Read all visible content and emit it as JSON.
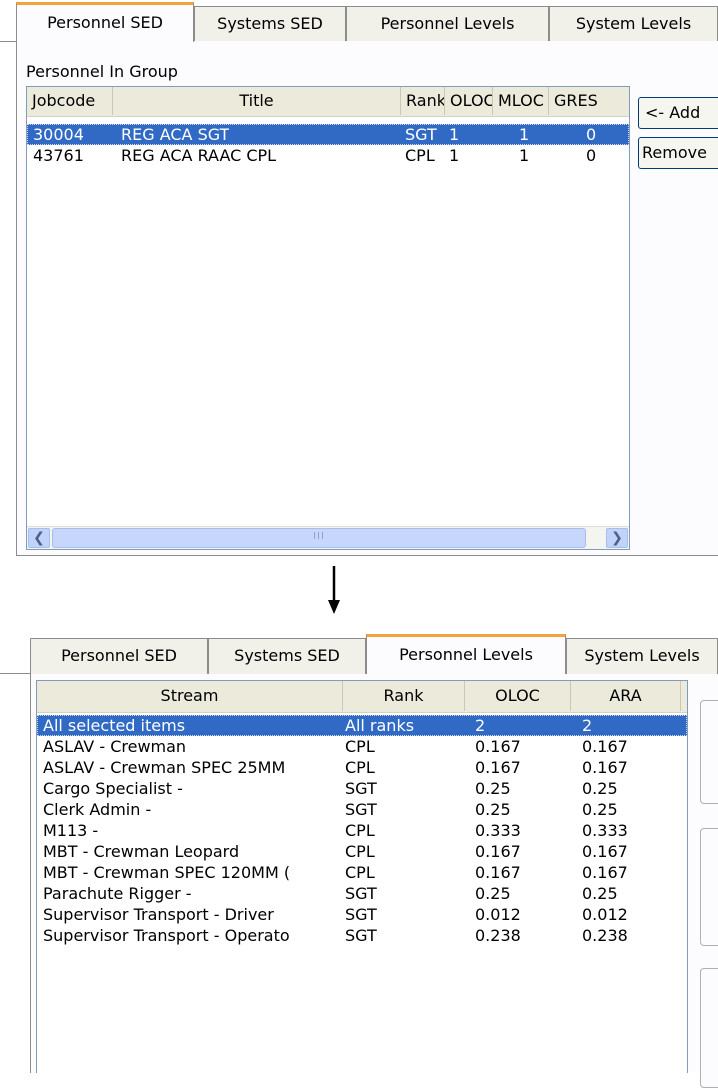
{
  "top": {
    "tabs": [
      "Personnel SED",
      "Systems SED",
      "Personnel Levels",
      "System Levels"
    ],
    "active_tab": 0,
    "group_label": "Personnel In Group",
    "columns": [
      "Jobcode",
      "Title",
      "Rank",
      "OLOC",
      "MLOC",
      "GRES"
    ],
    "rows": [
      {
        "jobcode": "30004",
        "title": "REG ACA SGT",
        "rank": "SGT",
        "oloc": "1",
        "mloc": "1",
        "gres": "0",
        "selected": true
      },
      {
        "jobcode": "43761",
        "title": "REG ACA RAAC CPL",
        "rank": "CPL",
        "oloc": "1",
        "mloc": "1",
        "gres": "0",
        "selected": false
      }
    ],
    "add_button": "<- Add",
    "remove_button": "Remove",
    "scroll_thumb_grip": "III"
  },
  "bottom": {
    "tabs": [
      "Personnel SED",
      "Systems SED",
      "Personnel Levels",
      "System Levels"
    ],
    "active_tab": 2,
    "columns": [
      "Stream",
      "Rank",
      "OLOC",
      "ARA"
    ],
    "rows": [
      {
        "stream": "All selected items",
        "rank": "All ranks",
        "oloc": "2",
        "ara": "2",
        "selected": true
      },
      {
        "stream": "ASLAV - Crewman",
        "rank": "CPL",
        "oloc": "0.167",
        "ara": "0.167",
        "selected": false
      },
      {
        "stream": "ASLAV - Crewman SPEC 25MM",
        "rank": "CPL",
        "oloc": "0.167",
        "ara": "0.167",
        "selected": false
      },
      {
        "stream": "Cargo Specialist -",
        "rank": "SGT",
        "oloc": "0.25",
        "ara": "0.25",
        "selected": false
      },
      {
        "stream": "Clerk Admin -",
        "rank": "SGT",
        "oloc": "0.25",
        "ara": "0.25",
        "selected": false
      },
      {
        "stream": "M113 -",
        "rank": "CPL",
        "oloc": "0.333",
        "ara": "0.333",
        "selected": false
      },
      {
        "stream": "MBT - Crewman Leopard",
        "rank": "CPL",
        "oloc": "0.167",
        "ara": "0.167",
        "selected": false
      },
      {
        "stream": "MBT - Crewman SPEC 120MM (",
        "rank": "CPL",
        "oloc": "0.167",
        "ara": "0.167",
        "selected": false
      },
      {
        "stream": "Parachute Rigger -",
        "rank": "SGT",
        "oloc": "0.25",
        "ara": "0.25",
        "selected": false
      },
      {
        "stream": "Supervisor Transport - Driver",
        "rank": "SGT",
        "oloc": "0.012",
        "ara": "0.012",
        "selected": false
      },
      {
        "stream": "Supervisor Transport - Operato",
        "rank": "SGT",
        "oloc": "0.238",
        "ara": "0.238",
        "selected": false
      }
    ]
  },
  "icons": {
    "arrow": "arrow-down-icon",
    "scroll_left": "scroll-left-icon",
    "scroll_right": "scroll-right-icon"
  },
  "colors": {
    "selection": "#316ac5",
    "active_tab_accent": "#f2a43b",
    "header_bg": "#ebeadb"
  }
}
